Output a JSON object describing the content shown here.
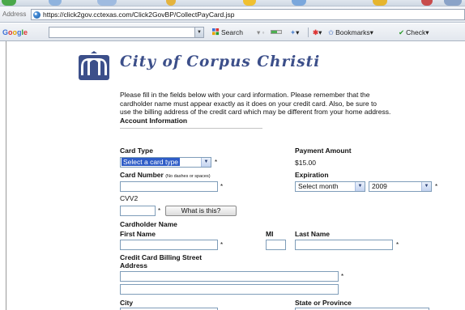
{
  "browser": {
    "address_label": "Address",
    "url": "https://click2gov.cctexas.com/Click2GovBP/CollectPayCard.jsp",
    "google_logo": [
      "G",
      "o",
      "o",
      "g",
      "l",
      "e"
    ],
    "google_search_value": "",
    "toolbar": {
      "search_label": "Search",
      "bookmarks_label": "Bookmarks",
      "check_label": "Check"
    }
  },
  "page": {
    "city_title": "City of Corpus Christi",
    "intro_lines": [
      "Please fill in the fields below with your card information. Please remember that the",
      "cardholder name must appear exactly as it does on your credit card. Also, be sure to",
      "use the billing address of the credit card which may be different from your home address."
    ],
    "section_title": "Account Information",
    "required_marker": "*",
    "card_type": {
      "label": "Card Type",
      "selected": "Select a card type"
    },
    "payment_amount": {
      "label": "Payment Amount",
      "value": "$15.00"
    },
    "card_number": {
      "label": "Card Number",
      "hint": "(No dashes or spaces)",
      "value": ""
    },
    "expiration": {
      "label": "Expiration",
      "month_selected": "Select month",
      "year_selected": "2009"
    },
    "cvv2": {
      "label": "CVV2",
      "value": "",
      "help_button": "What is this?"
    },
    "cardholder": {
      "label": "Cardholder Name",
      "first_name_label": "First Name",
      "mi_label": "MI",
      "last_name_label": "Last Name",
      "first_name": "",
      "mi": "",
      "last_name": ""
    },
    "billing": {
      "label_line1": "Credit Card Billing Street",
      "label_line2": "Address",
      "line1": "",
      "line2": ""
    },
    "city_label": "City",
    "state_label": "State or Province"
  },
  "colors": {
    "title": "#3c4f8a",
    "selection": "#2e5cc7",
    "input_border": "#7f9db9"
  }
}
